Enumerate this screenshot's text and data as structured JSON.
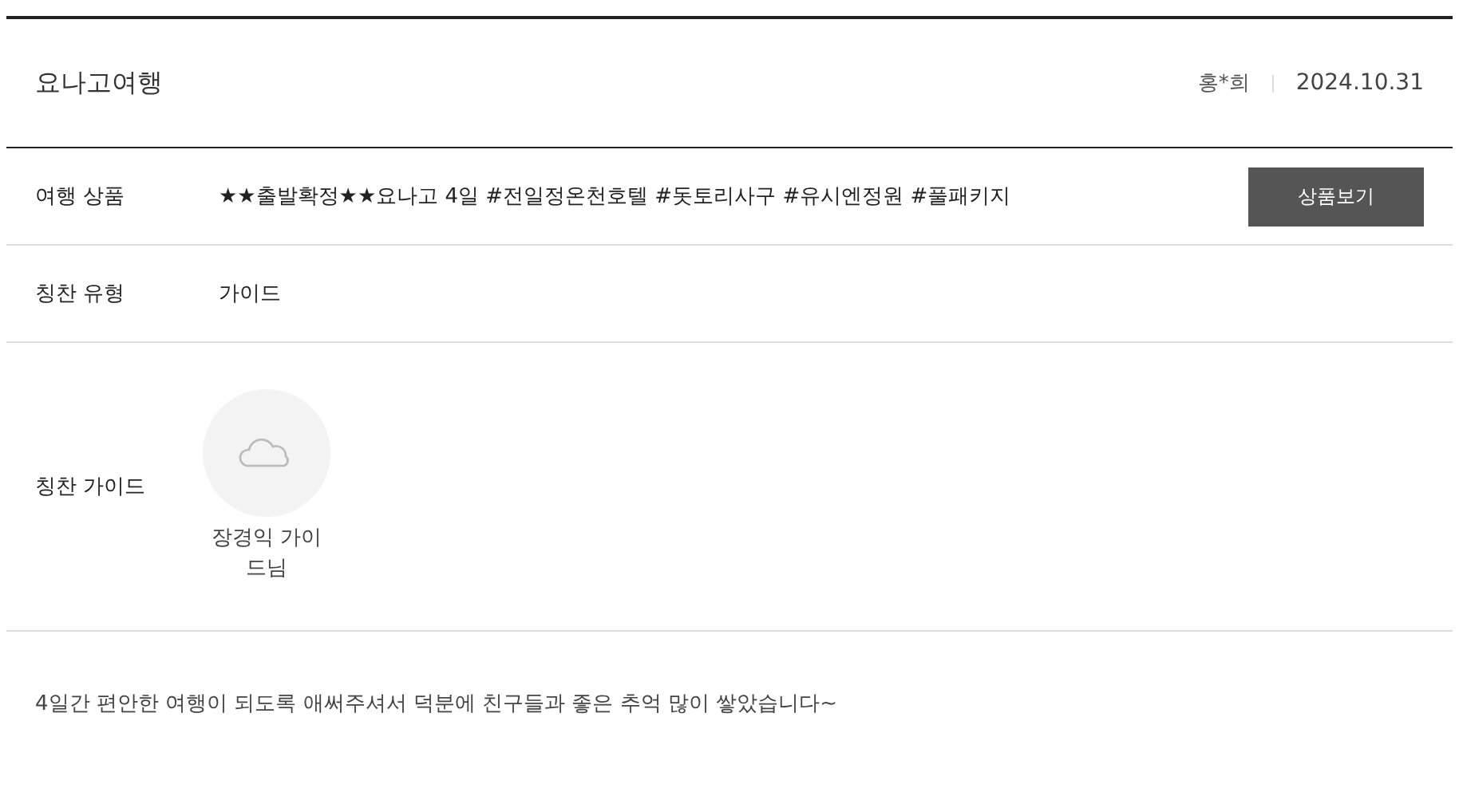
{
  "review": {
    "title": "요나고여행",
    "author": "홍*희",
    "date": "2024.10.31"
  },
  "rows": [
    {
      "kind": "product",
      "label": "여행 상품",
      "value": "★★출발확정★★요나고 4일 #전일정온천호텔 #돗토리사구 #유시엔정원 #풀패키지",
      "button": "상품보기"
    },
    {
      "kind": "text",
      "label": "칭찬 유형",
      "value": "가이드"
    },
    {
      "kind": "guide",
      "label": "칭찬 가이드",
      "guide_name": "장경익 가이드님"
    }
  ],
  "body": "4일간 편안한 여행이 되도록 애써주셔서 덕분에 친구들과 좋은 추억 많이 쌓았습니다~"
}
